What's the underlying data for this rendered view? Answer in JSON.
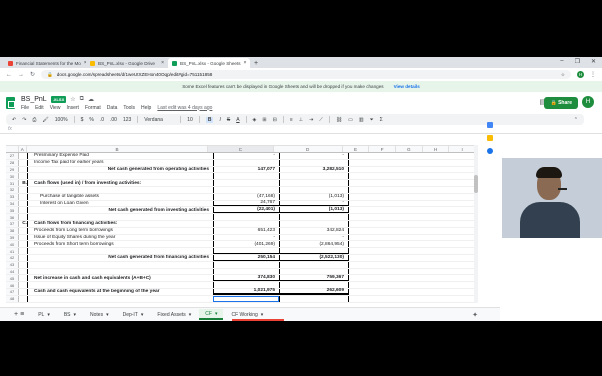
{
  "browser": {
    "tabs": [
      {
        "title": "Financial Statements for the Mo",
        "fav": "#ea4335"
      },
      {
        "title": "BS_PnL.xlsx - Google Drive",
        "fav": "#fbbc04"
      },
      {
        "title": "BS_PnL.xlsx - Google Sheets",
        "fav": "#0f9d58"
      }
    ],
    "url": "docs.google.com/spreadsheets/d/1weUtXZEHon40Oqp/edit#gid=751151858",
    "profile_initial": "H"
  },
  "banner": {
    "text": "Some Excel features can't be displayed in Google Sheets and will be dropped if you make changes",
    "link": "View details"
  },
  "doc": {
    "title": "BS_PnL",
    "badge": ".XLSX",
    "menus": [
      "File",
      "Edit",
      "View",
      "Insert",
      "Format",
      "Data",
      "Tools",
      "Help"
    ],
    "last_edit": "Last edit was 4 days ago",
    "share_label": "Share",
    "user_initial": "H"
  },
  "toolbar": {
    "zoom": "100%",
    "currency": "$",
    "percent": "%",
    "dec0": ".0",
    "dec00": ".00",
    "format123": "123",
    "font": "Verdana",
    "size": "10",
    "bold": "B",
    "italic": "I",
    "strike": "S",
    "textcolor": "A"
  },
  "columns": [
    "A",
    "B",
    "C",
    "D",
    "E",
    "F",
    "G",
    "H",
    "I"
  ],
  "rows": [
    {
      "n": "27",
      "b": "Preliminary Expense Paid",
      "c": "-",
      "d": "-",
      "style": ""
    },
    {
      "n": "28",
      "b": "Income Tax paid for earlier years",
      "c": "",
      "d": "",
      "style": ""
    },
    {
      "n": "29",
      "b": "Net cash generated from operating activities",
      "c": "147,077",
      "d": "3,282,510",
      "style": "bold total"
    },
    {
      "n": "30",
      "b": "",
      "c": "",
      "d": "",
      "style": ""
    },
    {
      "n": "31",
      "a": "B.",
      "b": "Cash flows (used in) / from investing activities:",
      "c": "",
      "d": "",
      "style": "bold"
    },
    {
      "n": "32",
      "b": "",
      "c": "",
      "d": "",
      "style": ""
    },
    {
      "n": "33",
      "b": "Purchase of tangible assets",
      "c": "(47,168)",
      "d": "(1,013)",
      "style": "indent"
    },
    {
      "n": "34",
      "b": "Interest on Loan Given",
      "c": "24,767",
      "d": "-",
      "style": "indent line"
    },
    {
      "n": "35",
      "b": "Net cash generated from investing activities",
      "c": "(22,401)",
      "d": "(1,013)",
      "style": "bold total line"
    },
    {
      "n": "36",
      "b": "",
      "c": "",
      "d": "",
      "style": ""
    },
    {
      "n": "37",
      "a": "C.",
      "b": "Cash flows from financing activities:",
      "c": "",
      "d": "",
      "style": "bold"
    },
    {
      "n": "38",
      "b": "Proceeds from Long term borrowings",
      "c": "651,423",
      "d": "342,824",
      "style": ""
    },
    {
      "n": "39",
      "b": "Issue of Equity Shares during the year",
      "c": "-",
      "d": "-",
      "style": ""
    },
    {
      "n": "40",
      "b": "Proceeds from Short term borrowings",
      "c": "(401,269)",
      "d": "(2,864,954)",
      "style": ""
    },
    {
      "n": "41",
      "b": "",
      "c": "",
      "d": "",
      "style": "line"
    },
    {
      "n": "42",
      "b": "Net cash generated from financing activities",
      "c": "250,154",
      "d": "(2,522,130)",
      "style": "bold total line"
    },
    {
      "n": "43",
      "b": "",
      "c": "",
      "d": "",
      "style": ""
    },
    {
      "n": "44",
      "b": "",
      "c": "",
      "d": "",
      "style": ""
    },
    {
      "n": "45",
      "b": "Net increase in cash and cash equivalents (A+B+C)",
      "c": "374,830",
      "d": "759,367",
      "style": "bold line"
    },
    {
      "n": "46",
      "b": "",
      "c": "",
      "d": "",
      "style": ""
    },
    {
      "n": "47",
      "b": "Cash and cash equivalents at the beginning of the year",
      "c": "1,021,975",
      "d": "262,609",
      "style": "bold dbl"
    },
    {
      "n": "48",
      "b": "",
      "c": "",
      "d": "",
      "style": "sel"
    }
  ],
  "sheet_tabs": [
    "PL",
    "BS",
    "Notes",
    "Dep-IT",
    "Fixed Assets",
    "CF",
    "CF Working"
  ],
  "active_sheet": "CF"
}
